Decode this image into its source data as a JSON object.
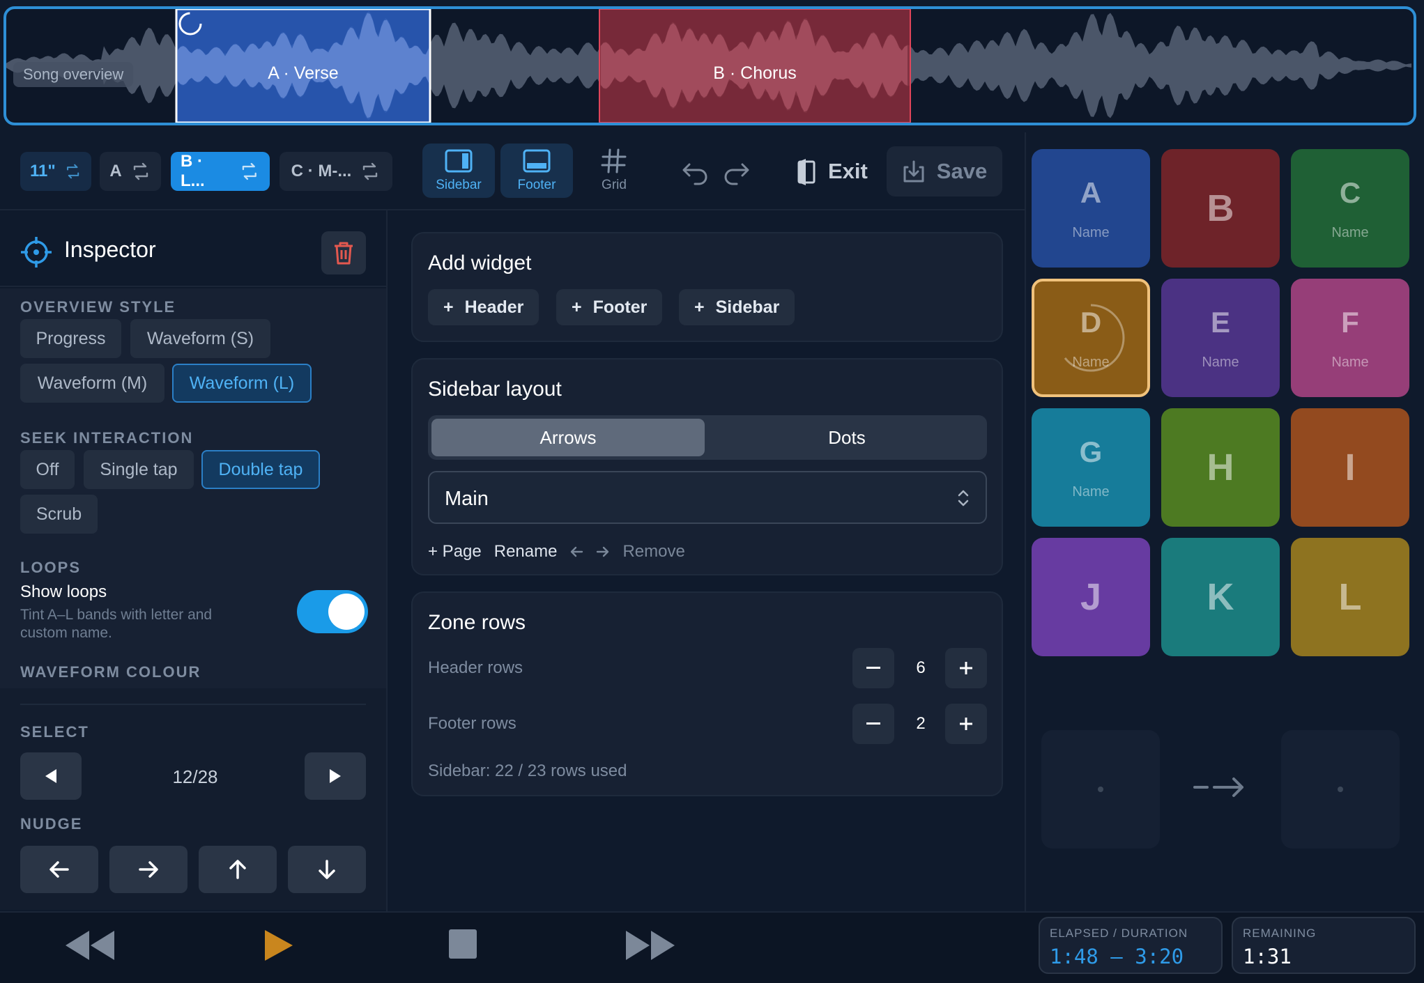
{
  "overview": {
    "label": "Song overview",
    "loops": [
      {
        "label": "A · Verse",
        "color": "#2d5fc2"
      },
      {
        "label": "B · Chorus",
        "color": "#8b2d3c"
      }
    ]
  },
  "toolbar": {
    "chips": [
      "11\"",
      "A",
      "B · L...",
      "C · M-..."
    ],
    "sidebar_label": "Sidebar",
    "footer_label": "Footer",
    "grid_label": "Grid",
    "exit_label": "Exit",
    "save_label": "Save"
  },
  "inspector": {
    "title": "Inspector",
    "overview_style": {
      "label": "OVERVIEW STYLE",
      "options": [
        "Progress",
        "Waveform (S)",
        "Waveform (M)",
        "Waveform (L)"
      ],
      "selected": "Waveform (L)"
    },
    "seek_interaction": {
      "label": "SEEK INTERACTION",
      "options": [
        "Off",
        "Single tap",
        "Double tap",
        "Scrub"
      ],
      "selected": "Double tap"
    },
    "loops": {
      "label": "LOOPS",
      "show_title": "Show loops",
      "show_desc": "Tint A–L bands with letter and custom name.",
      "enabled": true
    },
    "waveform_colour": {
      "label": "WAVEFORM COLOUR"
    },
    "select": {
      "label": "SELECT",
      "counter": "12/28"
    },
    "nudge": {
      "label": "NUDGE"
    }
  },
  "add_widget": {
    "title": "Add widget",
    "buttons": [
      "Header",
      "Footer",
      "Sidebar"
    ]
  },
  "sidebar_layout": {
    "title": "Sidebar layout",
    "modes": [
      "Arrows",
      "Dots"
    ],
    "selected_mode": "Arrows",
    "page": "Main",
    "actions": {
      "add_page": "+ Page",
      "rename": "Rename",
      "remove": "Remove"
    }
  },
  "zone_rows": {
    "title": "Zone rows",
    "header_label": "Header rows",
    "header_value": "6",
    "footer_label": "Footer rows",
    "footer_value": "2",
    "usage": "Sidebar: 22 / 23 rows used"
  },
  "pads": [
    {
      "letter": "A",
      "name": "Name",
      "color": "#22468f"
    },
    {
      "letter": "B",
      "name": "",
      "color": "#6e2329"
    },
    {
      "letter": "C",
      "name": "Name",
      "color": "#1f6035"
    },
    {
      "letter": "D",
      "name": "Name",
      "color": "#8a5c17"
    },
    {
      "letter": "E",
      "name": "Name",
      "color": "#4b3283"
    },
    {
      "letter": "F",
      "name": "Name",
      "color": "#963e78"
    },
    {
      "letter": "G",
      "name": "Name",
      "color": "#167c9a"
    },
    {
      "letter": "H",
      "name": "",
      "color": "#4d7a22"
    },
    {
      "letter": "I",
      "name": "",
      "color": "#934a1f"
    },
    {
      "letter": "J",
      "name": "",
      "color": "#673ba1"
    },
    {
      "letter": "K",
      "name": "",
      "color": "#1a7b7c"
    },
    {
      "letter": "L",
      "name": "",
      "color": "#8e7320"
    }
  ],
  "transport": {
    "elapsed_label": "ELAPSED / DURATION",
    "elapsed_value": "1:48 – 3:20",
    "remaining_label": "REMAINING",
    "remaining_value": "1:31",
    "accent": "#2f9be8",
    "play_color": "#c9861e"
  }
}
